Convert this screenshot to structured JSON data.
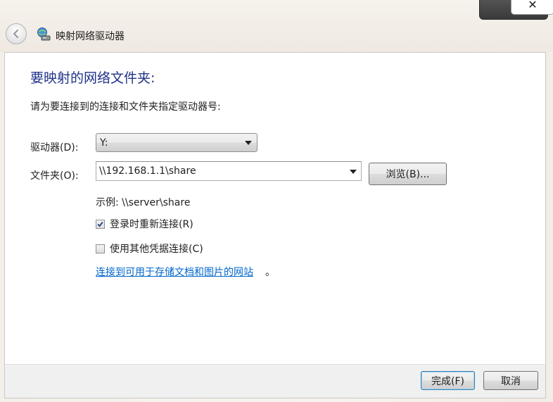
{
  "window": {
    "title": "映射网络驱动器",
    "close_label": "✕",
    "back_icon": "back-arrow-icon",
    "app_icon": "network-drive-icon"
  },
  "heading": "要映射的网络文件夹:",
  "instruction": "请为要连接到的连接和文件夹指定驱动器号:",
  "drive": {
    "label": "驱动器(D):",
    "selected": "Y:"
  },
  "folder": {
    "label": "文件夹(O):",
    "value": "\\\\192.168.1.1\\share",
    "browse_label": "浏览(B)..."
  },
  "example": "示例: \\\\server\\share",
  "options": [
    {
      "label": "登录时重新连接(R)",
      "checked": true
    },
    {
      "label": "使用其他凭据连接(C)",
      "checked": false
    }
  ],
  "link": {
    "text": "连接到可用于存储文档和图片的网站",
    "suffix": "。"
  },
  "footer": {
    "finish_label": "完成(F)",
    "cancel_label": "取消"
  },
  "colors": {
    "heading": "#1e3287",
    "link": "#0066cc",
    "default_button_border": "#3c7fb1"
  }
}
